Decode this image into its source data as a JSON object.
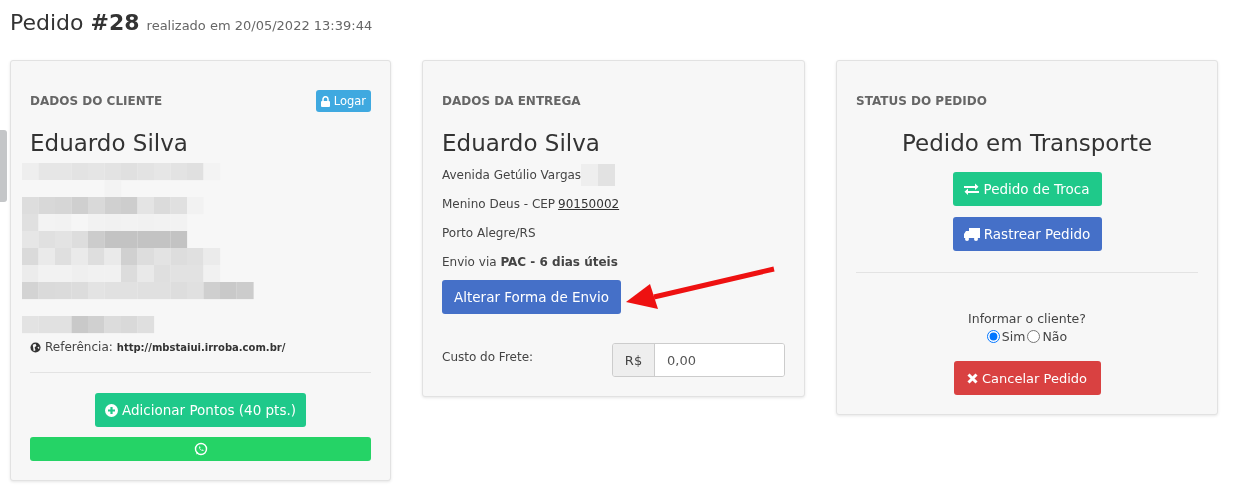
{
  "title": {
    "prefix": "Pedido",
    "number": "#28",
    "subtitle": "realizado em 20/05/2022 13:39:44"
  },
  "customer": {
    "heading": "DADOS DO CLIENTE",
    "login_button": "Logar",
    "name": "Eduardo Silva",
    "reference_label": "Referência:",
    "reference_url": "http://mbstaiui.irroba.com.br/",
    "points_button": "Adicionar Pontos (40 pts.)"
  },
  "delivery": {
    "heading": "DADOS DA ENTREGA",
    "name": "Eduardo Silva",
    "street": "Avenida Getúlio Vargas",
    "district": "Menino Deus - CEP",
    "cep": "90150002",
    "city": "Porto Alegre/RS",
    "shipping": "Envio via **PAC - 6 dias úteis**",
    "change_button": "Alterar Forma de Envio",
    "freight_label": "Custo do Frete:",
    "currency": "R$",
    "freight_value": "0,00"
  },
  "status": {
    "heading": "STATUS DO PEDIDO",
    "state": "Pedido em Transporte",
    "exchange_button": "Pedido de Troca",
    "track_button": "Rastrear Pedido",
    "notify_question": "Informar o cliente?",
    "notify_options": [
      {
        "label": "Sim",
        "selected": true
      },
      {
        "label": "Não",
        "selected": false
      }
    ],
    "cancel_button": "Cancelar Pedido"
  }
}
